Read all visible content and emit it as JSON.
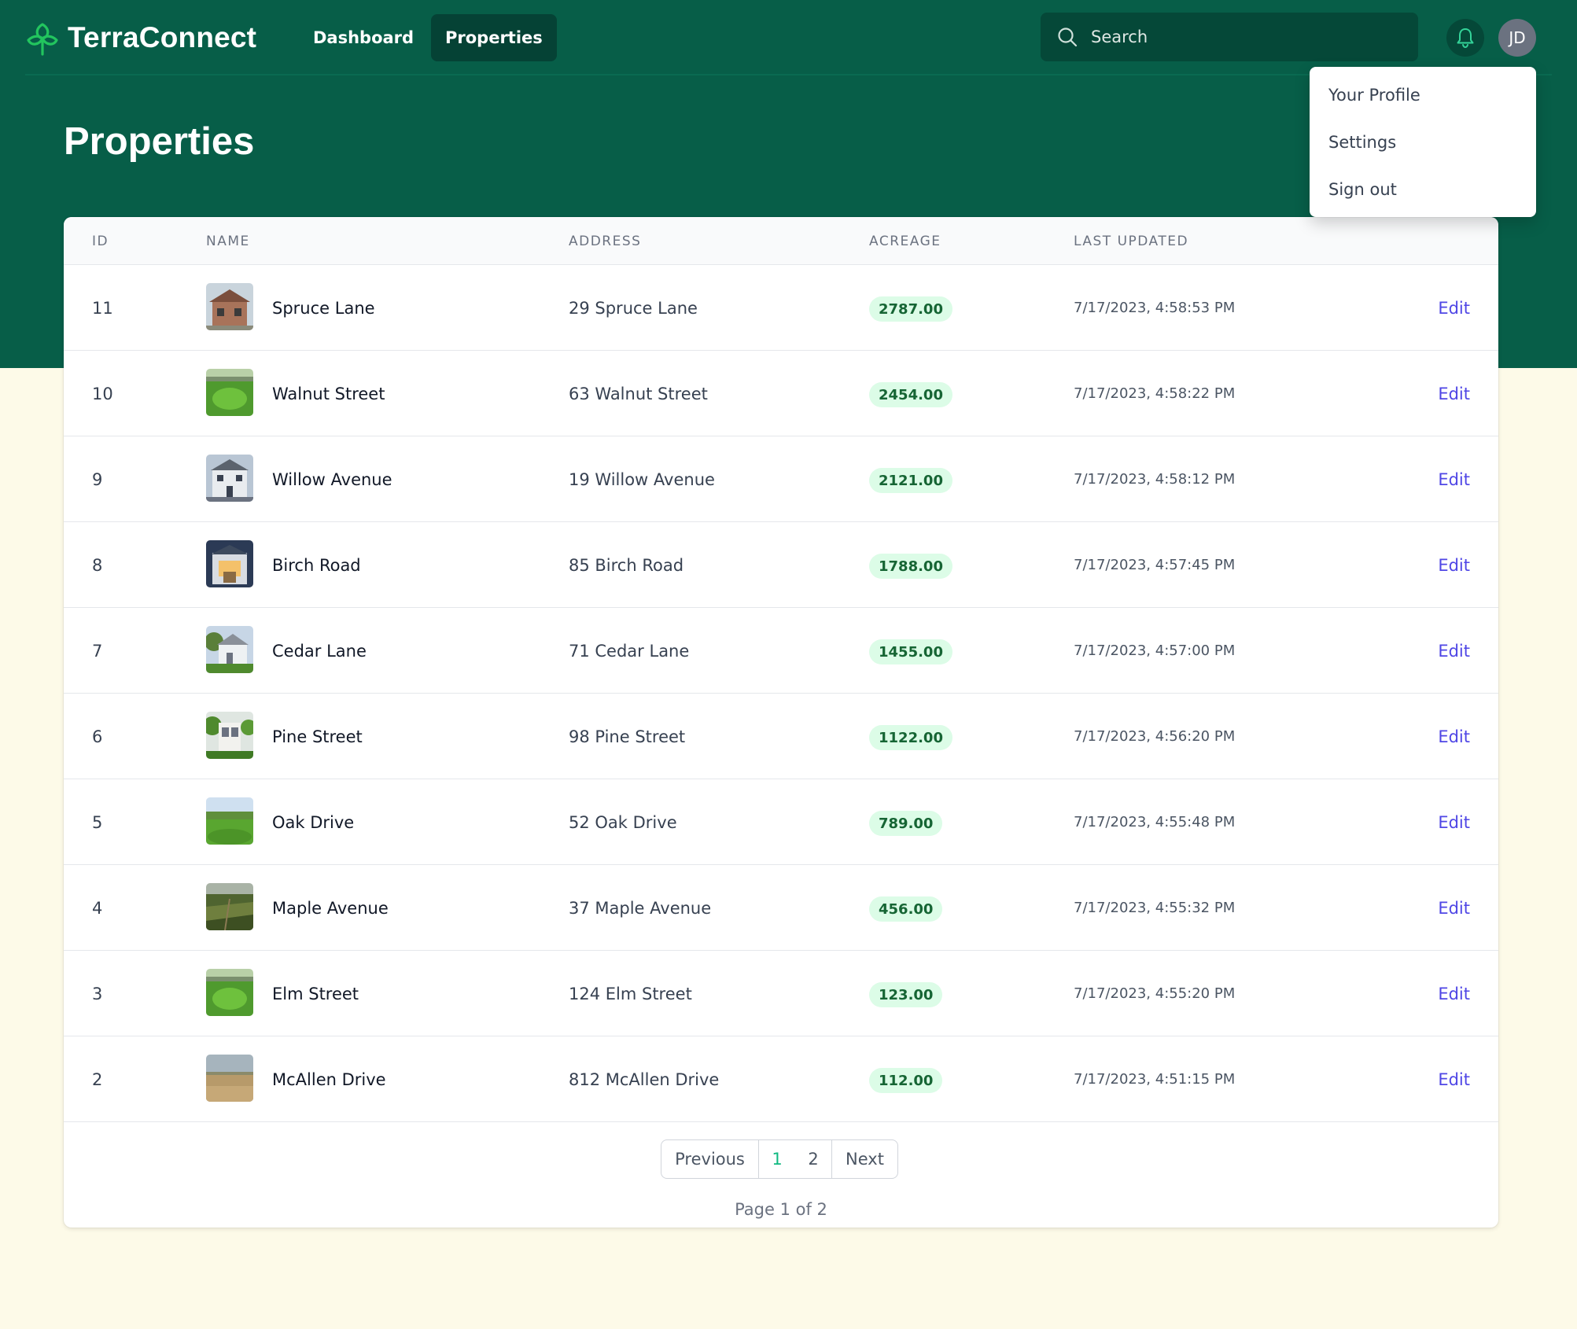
{
  "app": {
    "name": "TerraConnect"
  },
  "nav": [
    {
      "label": "Dashboard",
      "active": false
    },
    {
      "label": "Properties",
      "active": true
    }
  ],
  "search": {
    "placeholder": "Search",
    "value": ""
  },
  "user": {
    "initials": "JD"
  },
  "user_menu": [
    "Your Profile",
    "Settings",
    "Sign out"
  ],
  "page": {
    "title": "Properties"
  },
  "table": {
    "columns": [
      "ID",
      "NAME",
      "ADDRESS",
      "ACREAGE",
      "LAST UPDATED"
    ],
    "edit_label": "Edit",
    "rows": [
      {
        "id": "11",
        "name": "Spruce Lane",
        "address": "29 Spruce Lane",
        "acreage": "2787.00",
        "updated": "7/17/2023, 4:58:53 PM",
        "thumb": "house-brick"
      },
      {
        "id": "10",
        "name": "Walnut Street",
        "address": "63 Walnut Street",
        "acreage": "2454.00",
        "updated": "7/17/2023, 4:58:22 PM",
        "thumb": "green-field"
      },
      {
        "id": "9",
        "name": "Willow Avenue",
        "address": "19 Willow Avenue",
        "acreage": "2121.00",
        "updated": "7/17/2023, 4:58:12 PM",
        "thumb": "house-white"
      },
      {
        "id": "8",
        "name": "Birch Road",
        "address": "85 Birch Road",
        "acreage": "1788.00",
        "updated": "7/17/2023, 4:57:45 PM",
        "thumb": "house-night"
      },
      {
        "id": "7",
        "name": "Cedar Lane",
        "address": "71 Cedar Lane",
        "acreage": "1455.00",
        "updated": "7/17/2023, 4:57:00 PM",
        "thumb": "house-trees"
      },
      {
        "id": "6",
        "name": "Pine Street",
        "address": "98 Pine Street",
        "acreage": "1122.00",
        "updated": "7/17/2023, 4:56:20 PM",
        "thumb": "house-modern"
      },
      {
        "id": "5",
        "name": "Oak Drive",
        "address": "52 Oak Drive",
        "acreage": "789.00",
        "updated": "7/17/2023, 4:55:48 PM",
        "thumb": "lawn"
      },
      {
        "id": "4",
        "name": "Maple Avenue",
        "address": "37 Maple Avenue",
        "acreage": "456.00",
        "updated": "7/17/2023, 4:55:32 PM",
        "thumb": "farmland"
      },
      {
        "id": "3",
        "name": "Elm Street",
        "address": "124 Elm Street",
        "acreage": "123.00",
        "updated": "7/17/2023, 4:55:20 PM",
        "thumb": "green-field"
      },
      {
        "id": "2",
        "name": "McAllen Drive",
        "address": "812 McAllen Drive",
        "acreage": "112.00",
        "updated": "7/17/2023, 4:51:15 PM",
        "thumb": "dry-field"
      }
    ]
  },
  "pagination": {
    "previous_label": "Previous",
    "next_label": "Next",
    "pages": [
      "1",
      "2"
    ],
    "current_page": "1",
    "info": "Page 1 of 2"
  },
  "colors": {
    "header_green": "#075e48",
    "page_background": "#fdfae8",
    "badge_background": "#dcfce7",
    "badge_text": "#166534",
    "link": "#4f46e5",
    "current_page": "#10b981"
  }
}
